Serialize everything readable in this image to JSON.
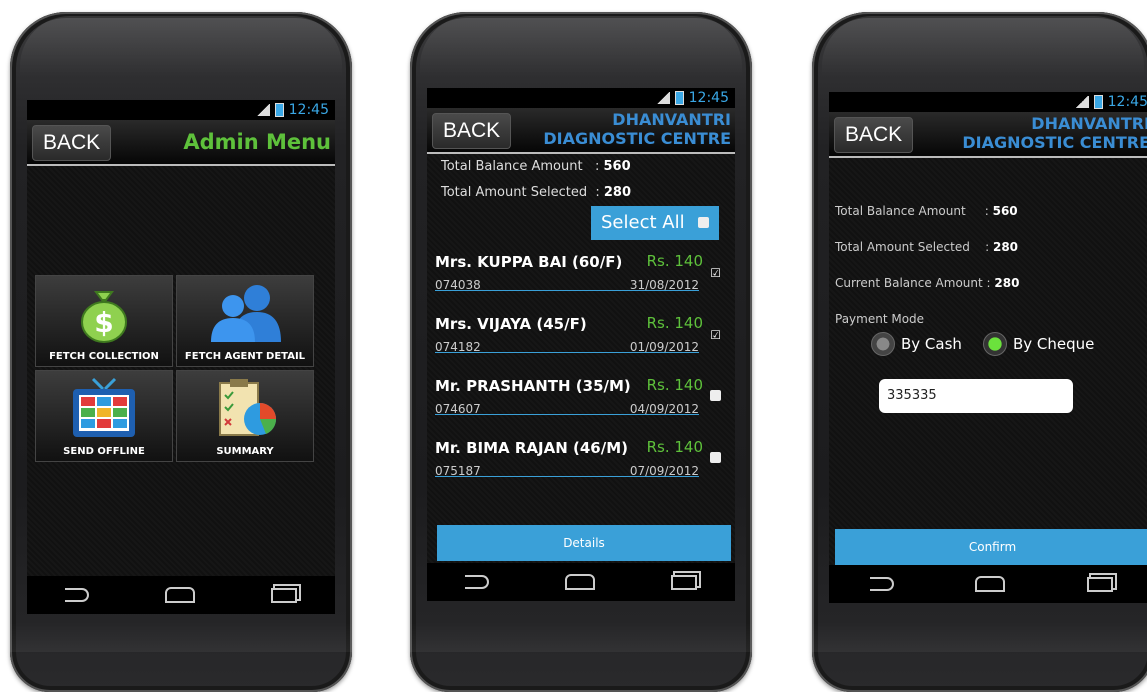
{
  "status": {
    "time": "12:45",
    "network": "3G"
  },
  "phone1": {
    "back_label": "BACK",
    "title": "Admin Menu",
    "tiles": [
      {
        "label": "FETCH COLLECTION",
        "icon": "money-bag-icon"
      },
      {
        "label": "FETCH AGENT DETAIL",
        "icon": "users-icon"
      },
      {
        "label": "SEND OFFLINE",
        "icon": "tv-icon"
      },
      {
        "label": "SUMMARY",
        "icon": "report-chart-icon"
      }
    ]
  },
  "phone2": {
    "back_label": "BACK",
    "brand_line1": "DHANVANTRI",
    "brand_line2": "DIAGNOSTIC CENTRE",
    "total_balance_label": "Total Balance Amount",
    "total_balance_value": "560",
    "total_selected_label": "Total Amount Selected",
    "total_selected_value": "280",
    "select_all_label": "Select All",
    "patients": [
      {
        "name": "Mrs. KUPPA BAI (60/F)",
        "amount": "Rs. 140",
        "id": "074038",
        "date": "31/08/2012",
        "checked": true
      },
      {
        "name": "Mrs. VIJAYA (45/F)",
        "amount": "Rs. 140",
        "id": "074182",
        "date": "01/09/2012",
        "checked": true
      },
      {
        "name": "Mr. PRASHANTH (35/M)",
        "amount": "Rs. 140",
        "id": "074607",
        "date": "04/09/2012",
        "checked": false
      },
      {
        "name": "Mr. BIMA RAJAN (46/M)",
        "amount": "Rs. 140",
        "id": "075187",
        "date": "07/09/2012",
        "checked": false
      }
    ],
    "details_label": "Details"
  },
  "phone3": {
    "back_label": "BACK",
    "brand_line1": "DHANVANTRI",
    "brand_line2": "DIAGNOSTIC CENTRE",
    "total_balance_label": "Total Balance Amount",
    "total_balance_value": "560",
    "total_selected_label": "Total Amount Selected",
    "total_selected_value": "280",
    "current_balance_label": "Current Balance Amount",
    "current_balance_value": "280",
    "payment_mode_label": "Payment Mode",
    "by_cash_label": "By Cash",
    "by_cheque_label": "By Cheque",
    "selected_mode": "By Cheque",
    "cheque_value": "335335",
    "confirm_label": "Confirm"
  },
  "colors": {
    "accent_blue": "#3aa0d8",
    "accent_green": "#5ec13b"
  }
}
